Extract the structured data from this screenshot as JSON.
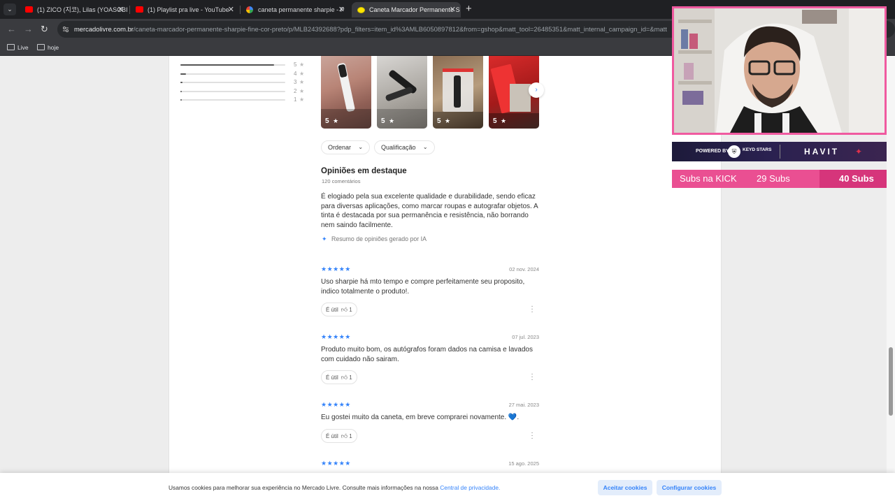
{
  "browser": {
    "tabs": [
      {
        "title": "(1) ZICO (지코), Lilas (YOASOBI",
        "icon": "youtube-icon",
        "active": false
      },
      {
        "title": "(1) Playlist pra live - YouTube",
        "icon": "youtube-icon",
        "active": false
      },
      {
        "title": "caneta permanente sharpie - P",
        "icon": "google-icon",
        "active": false
      },
      {
        "title": "Caneta Marcador Permanente S",
        "icon": "mercadolivre-icon",
        "active": true
      }
    ],
    "new_tab": "+",
    "url_domain": "mercadolivre.com.br",
    "url_path": "/caneta-marcador-permanente-sharpie-fine-cor-preto/p/MLB24392688?pdp_filters=item_id%3AMLB6050897812&from=gshop&matt_tool=26485351&matt_internal_campaign_id=&matt",
    "bookmarks": [
      "Live",
      "hoje"
    ]
  },
  "ratings": {
    "rows": [
      {
        "label": "5",
        "fraction": 0.89
      },
      {
        "label": "4",
        "fraction": 0.05
      },
      {
        "label": "3",
        "fraction": 0.02
      },
      {
        "label": "2",
        "fraction": 0.01
      },
      {
        "label": "1",
        "fraction": 0.01
      }
    ]
  },
  "photos": [
    {
      "score": "5"
    },
    {
      "score": "5"
    },
    {
      "score": "5"
    },
    {
      "score": "5"
    }
  ],
  "filters": {
    "sort": "Ordenar",
    "rating": "Qualificação"
  },
  "opinions": {
    "title": "Opiniões em destaque",
    "count": "120 comentários",
    "summary": "É elogiado pela sua excelente qualidade e durabilidade, sendo eficaz para diversas aplicações, como marcar roupas e autografar objetos. A tinta é destacada por sua permanência e resistência, não borrando nem saindo facilmente.",
    "ai_note": "Resumo de opiniões gerado por IA"
  },
  "reviews": [
    {
      "stars": "★★★★★",
      "date": "02 nov. 2024",
      "text": "Uso sharpie há mto tempo e compre perfeitamente seu proposito, indico totalmente o produto!.",
      "useful_label": "É útil",
      "useful_count": "1"
    },
    {
      "stars": "★★★★★",
      "date": "07 jul. 2023",
      "text": "Produto muito bom, os autógrafos foram dados na camisa e lavados com cuidado não sairam.",
      "useful_label": "É útil",
      "useful_count": "1"
    },
    {
      "stars": "★★★★★",
      "date": "27 mai. 2023",
      "text": "Eu gostei muito da caneta, em breve comprarei novamente. 💙.",
      "useful_label": "É útil",
      "useful_count": "1"
    },
    {
      "stars": "★★★★★",
      "date": "15 ago. 2025",
      "text": "",
      "useful_label": "",
      "useful_count": ""
    }
  ],
  "cookie": {
    "text": "Usamos cookies para melhorar sua experiência no Mercado Livre. Consulte mais informações na nossa ",
    "link": "Central de privacidade.",
    "accept": "Aceitar cookies",
    "configure": "Configurar cookies"
  },
  "overlay": {
    "sponsor_powered": "POWERED BY",
    "sponsor_keyd": "KEYD STARS",
    "sponsor_brand": "HAVIT",
    "subs_label": "Subs na KICK",
    "subs_count": "29 Subs",
    "subs_goal": "40 Subs"
  },
  "colors": {
    "accent": "#3483fa",
    "overlay_pink": "#ea4f92"
  }
}
